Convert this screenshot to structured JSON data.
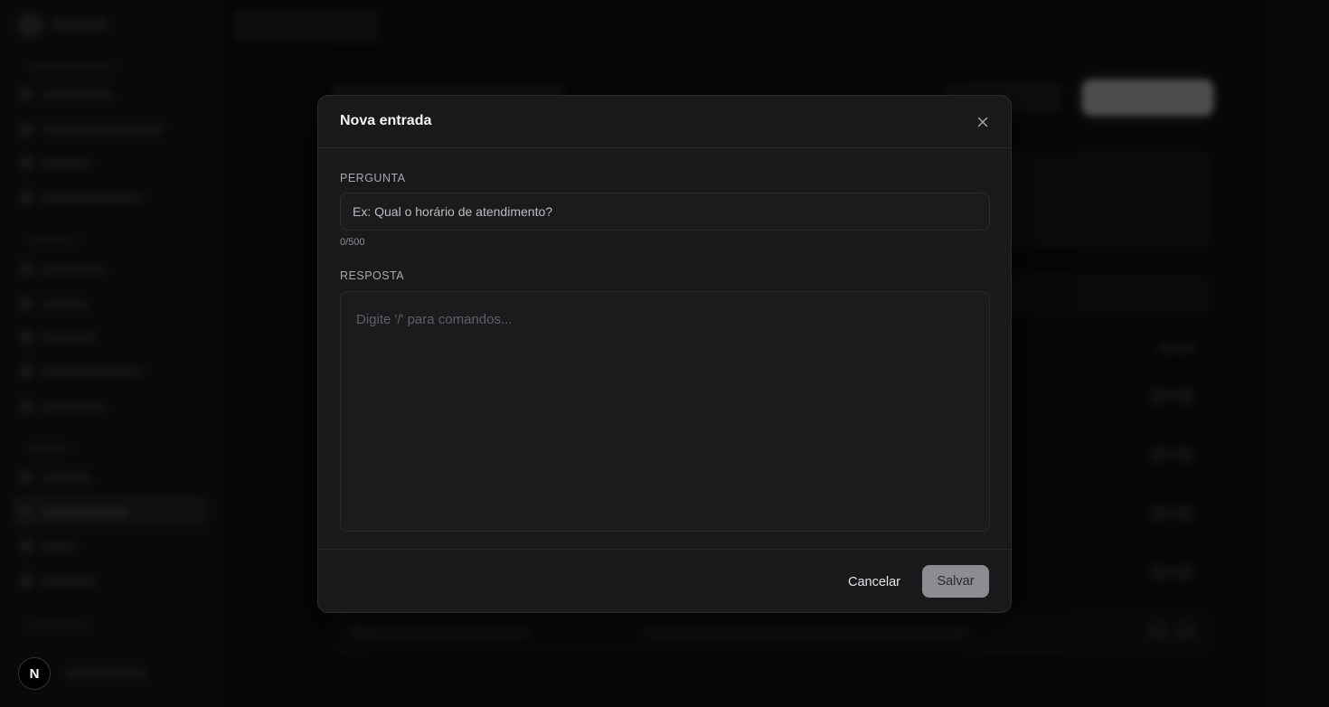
{
  "modal": {
    "title": "Nova entrada",
    "question_label": "PERGUNTA",
    "question_placeholder": "Ex: Qual o horário de atendimento?",
    "question_value": "",
    "char_counter": "0/500",
    "answer_label": "RESPOSTA",
    "answer_placeholder": "Digite '/' para comandos...",
    "answer_value": "",
    "cancel_label": "Cancelar",
    "save_label": "Salvar"
  },
  "avatar": {
    "initial": "N"
  },
  "colors": {
    "modal_bg": "#19191b",
    "save_button_bg": "#8d8d91",
    "page_bg": "#0a0a0b"
  }
}
